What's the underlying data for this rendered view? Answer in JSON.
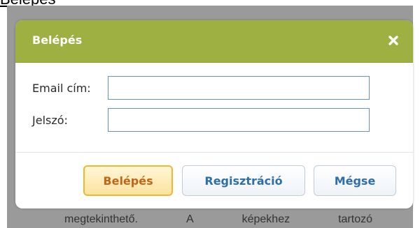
{
  "background": {
    "heading": "Belépés",
    "text_fragments": [
      "megtekinthető.",
      "A",
      "képekhez",
      "tartozó"
    ]
  },
  "dialog": {
    "title": "Belépés",
    "close_icon": "close-x-icon",
    "fields": {
      "email": {
        "label": "Email cím:",
        "value": "",
        "placeholder": ""
      },
      "password": {
        "label": "Jelszó:",
        "value": "",
        "placeholder": ""
      }
    },
    "buttons": {
      "login": "Belépés",
      "register": "Regisztráció",
      "cancel": "Mégse"
    }
  },
  "colors": {
    "titlebar": "#9fb043",
    "primary_button_border": "#f2b732",
    "primary_button_text": "#c0651a",
    "secondary_button_text": "#2f6fa8",
    "overlay": "#9a9a9a"
  }
}
